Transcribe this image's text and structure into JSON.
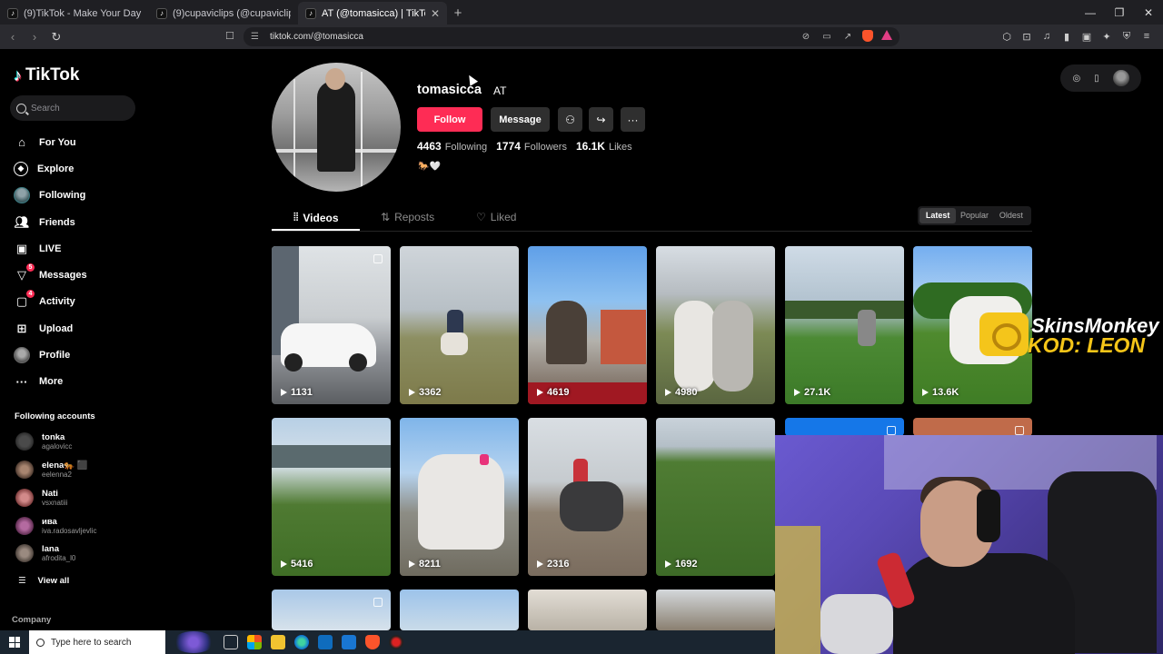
{
  "browser": {
    "tabs": [
      {
        "title": "(9)TikTok - Make Your Day"
      },
      {
        "title": "(9)cupaviclips (@cupaviclips) | TikTok"
      },
      {
        "title": "AT (@tomasicca) | TikTok"
      }
    ],
    "url": "tiktok.com/@tomasicca"
  },
  "sidebar": {
    "logo": "TikTok",
    "search_placeholder": "Search",
    "nav": [
      {
        "label": "For You",
        "icon": "home-icon"
      },
      {
        "label": "Explore",
        "icon": "compass-icon"
      },
      {
        "label": "Following",
        "icon": "following-avatar-icon"
      },
      {
        "label": "Friends",
        "icon": "friends-icon"
      },
      {
        "label": "LIVE",
        "icon": "live-icon"
      },
      {
        "label": "Messages",
        "icon": "messages-icon",
        "badge": "5"
      },
      {
        "label": "Activity",
        "icon": "activity-icon",
        "badge": "4"
      },
      {
        "label": "Upload",
        "icon": "upload-icon"
      },
      {
        "label": "Profile",
        "icon": "profile-icon"
      },
      {
        "label": "More",
        "icon": "more-icon"
      }
    ],
    "following_title": "Following accounts",
    "accounts": [
      {
        "name": "tonka",
        "handle": "agalovicc"
      },
      {
        "name": "elena🐅 ⬛",
        "handle": "eelenna2"
      },
      {
        "name": "Nati",
        "handle": "vsxnatiii"
      },
      {
        "name": "ива",
        "handle": "iva.radosavljevlic"
      },
      {
        "name": "lana",
        "handle": "afrodita_l0"
      }
    ],
    "view_all": "View all",
    "company": "Company"
  },
  "profile": {
    "username": "tomasicca",
    "nickname": "AT",
    "follow": "Follow",
    "message": "Message",
    "following_count": "4463",
    "following_label": "Following",
    "followers_count": "1774",
    "followers_label": "Followers",
    "likes_count": "16.1K",
    "likes_label": "Likes",
    "bio": "🐎🤍"
  },
  "tabs": {
    "videos": "Videos",
    "reposts": "Reposts",
    "liked": "Liked"
  },
  "sort": [
    "Latest",
    "Popular",
    "Oldest"
  ],
  "videos": [
    {
      "views": "1131"
    },
    {
      "views": "3362"
    },
    {
      "views": "4619"
    },
    {
      "views": "4980"
    },
    {
      "views": "27.1K"
    },
    {
      "views": "13.6K"
    },
    {
      "views": "5416"
    },
    {
      "views": "8211"
    },
    {
      "views": "2316"
    },
    {
      "views": "1692"
    }
  ],
  "overlay": {
    "sponsor_line1": "SkinsMonkey",
    "sponsor_line2": "KOD: LEON"
  },
  "taskbar": {
    "search_placeholder": "Type here to search"
  }
}
